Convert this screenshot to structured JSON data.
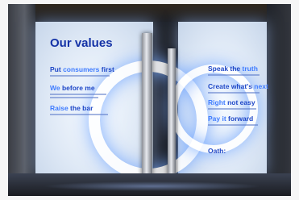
{
  "photo": {
    "description_free": true
  },
  "left_panel": {
    "title": "Our values",
    "values": [
      {
        "pre": "Put ",
        "highlight": "consumers",
        "post": " first"
      },
      {
        "pre": "",
        "highlight": "We",
        "post": " before me"
      },
      {
        "pre": "",
        "highlight": "Raise",
        "post": " the bar"
      }
    ]
  },
  "right_panel": {
    "values": [
      {
        "pre": "Speak the ",
        "highlight": "truth",
        "post": ""
      },
      {
        "pre": "Create what's ",
        "highlight": "next",
        "post": ""
      },
      {
        "pre": "",
        "highlight": "Right",
        "post": " not easy"
      },
      {
        "pre": "",
        "highlight": "Pay it",
        "post": " forward"
      },
      {
        "pre": "Oath:",
        "highlight": "",
        "post": ""
      }
    ]
  },
  "colors": {
    "text_blue": "#1f48c8",
    "highlight_blue": "#3f7cff",
    "glow": "#dfe9f6"
  }
}
